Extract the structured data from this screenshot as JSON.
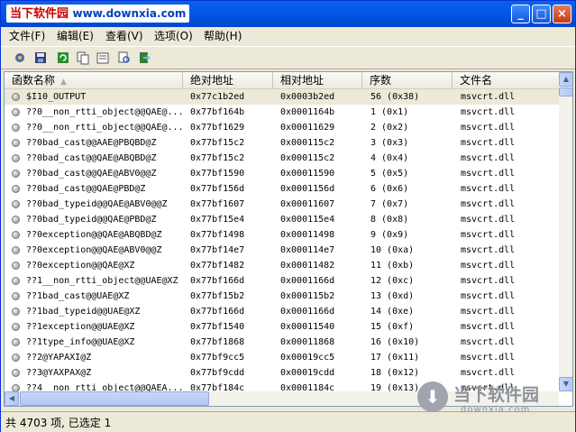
{
  "window": {
    "title_main": "当下软件园",
    "title_site": "www.downxia.com",
    "buttons": {
      "minimize": "_",
      "maximize": "□",
      "close": "×"
    }
  },
  "menu": [
    "文件(F)",
    "编辑(E)",
    "查看(V)",
    "选项(O)",
    "帮助(H)"
  ],
  "toolbar": {
    "icons": [
      "hash-options-icon",
      "save-icon",
      "refresh-icon",
      "copy-icon",
      "properties-icon",
      "find-icon",
      "exit-icon"
    ]
  },
  "table": {
    "columns": [
      "函数名称",
      "绝对地址",
      "相对地址",
      "序数",
      "文件名"
    ],
    "rows": [
      {
        "name": "$I10_OUTPUT",
        "abs": "0x77c1b2ed",
        "rel": "0x0003b2ed",
        "ord": "56 (0x38)",
        "file": "msvcrt.dll"
      },
      {
        "name": "??0__non_rtti_object@@QAE@...",
        "abs": "0x77bf164b",
        "rel": "0x0001164b",
        "ord": "1 (0x1)",
        "file": "msvcrt.dll"
      },
      {
        "name": "??0__non_rtti_object@@QAE@...",
        "abs": "0x77bf1629",
        "rel": "0x00011629",
        "ord": "2 (0x2)",
        "file": "msvcrt.dll"
      },
      {
        "name": "??0bad_cast@@AAE@PBQBD@Z",
        "abs": "0x77bf15c2",
        "rel": "0x000115c2",
        "ord": "3 (0x3)",
        "file": "msvcrt.dll"
      },
      {
        "name": "??0bad_cast@@QAE@ABQBD@Z",
        "abs": "0x77bf15c2",
        "rel": "0x000115c2",
        "ord": "4 (0x4)",
        "file": "msvcrt.dll"
      },
      {
        "name": "??0bad_cast@@QAE@ABV0@@Z",
        "abs": "0x77bf1590",
        "rel": "0x00011590",
        "ord": "5 (0x5)",
        "file": "msvcrt.dll"
      },
      {
        "name": "??0bad_cast@@QAE@PBD@Z",
        "abs": "0x77bf156d",
        "rel": "0x0001156d",
        "ord": "6 (0x6)",
        "file": "msvcrt.dll"
      },
      {
        "name": "??0bad_typeid@@QAE@ABV0@@Z",
        "abs": "0x77bf1607",
        "rel": "0x00011607",
        "ord": "7 (0x7)",
        "file": "msvcrt.dll"
      },
      {
        "name": "??0bad_typeid@@QAE@PBD@Z",
        "abs": "0x77bf15e4",
        "rel": "0x000115e4",
        "ord": "8 (0x8)",
        "file": "msvcrt.dll"
      },
      {
        "name": "??0exception@@QAE@ABQBD@Z",
        "abs": "0x77bf1498",
        "rel": "0x00011498",
        "ord": "9 (0x9)",
        "file": "msvcrt.dll"
      },
      {
        "name": "??0exception@@QAE@ABV0@@Z",
        "abs": "0x77bf14e7",
        "rel": "0x000114e7",
        "ord": "10 (0xa)",
        "file": "msvcrt.dll"
      },
      {
        "name": "??0exception@@QAE@XZ",
        "abs": "0x77bf1482",
        "rel": "0x00011482",
        "ord": "11 (0xb)",
        "file": "msvcrt.dll"
      },
      {
        "name": "??1__non_rtti_object@@UAE@XZ",
        "abs": "0x77bf166d",
        "rel": "0x0001166d",
        "ord": "12 (0xc)",
        "file": "msvcrt.dll"
      },
      {
        "name": "??1bad_cast@@UAE@XZ",
        "abs": "0x77bf15b2",
        "rel": "0x000115b2",
        "ord": "13 (0xd)",
        "file": "msvcrt.dll"
      },
      {
        "name": "??1bad_typeid@@UAE@XZ",
        "abs": "0x77bf166d",
        "rel": "0x0001166d",
        "ord": "14 (0xe)",
        "file": "msvcrt.dll"
      },
      {
        "name": "??1exception@@UAE@XZ",
        "abs": "0x77bf1540",
        "rel": "0x00011540",
        "ord": "15 (0xf)",
        "file": "msvcrt.dll"
      },
      {
        "name": "??1type_info@@UAE@XZ",
        "abs": "0x77bf1868",
        "rel": "0x00011868",
        "ord": "16 (0x10)",
        "file": "msvcrt.dll"
      },
      {
        "name": "??2@YAPAXI@Z",
        "abs": "0x77bf9cc5",
        "rel": "0x00019cc5",
        "ord": "17 (0x11)",
        "file": "msvcrt.dll"
      },
      {
        "name": "??3@YAXPAX@Z",
        "abs": "0x77bf9cdd",
        "rel": "0x00019cdd",
        "ord": "18 (0x12)",
        "file": "msvcrt.dll"
      },
      {
        "name": "??4__non_rtti_object@@QAEA...",
        "abs": "0x77bf184c",
        "rel": "0x0001184c",
        "ord": "19 (0x13)",
        "file": "msvcrt.dll"
      }
    ]
  },
  "status": "共 4703 项, 已选定 1",
  "watermark": {
    "title": "当下软件园",
    "sub": "downxia.com"
  }
}
